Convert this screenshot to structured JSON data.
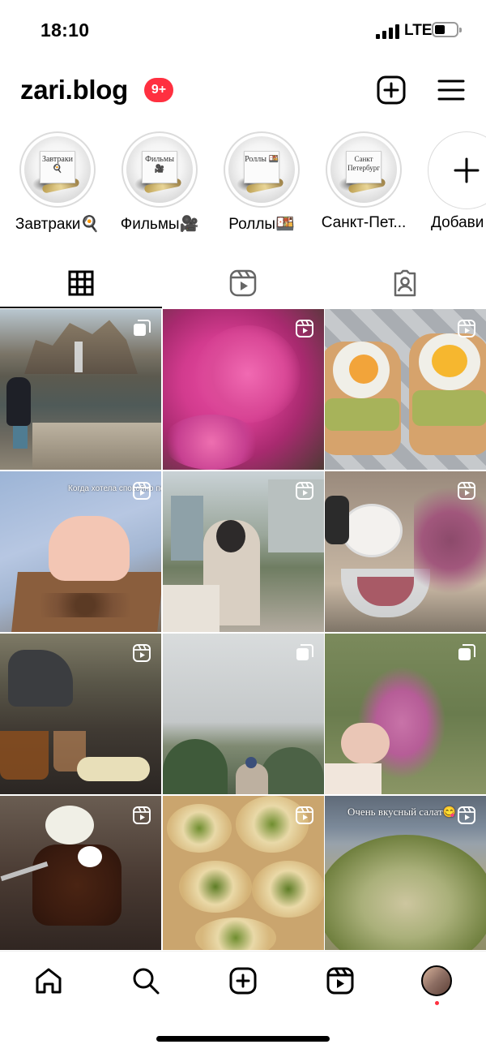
{
  "status_bar": {
    "time": "18:10",
    "network": "LTE"
  },
  "header": {
    "username": "zari.blog",
    "notification_badge": "9+"
  },
  "highlights": [
    {
      "label": "Завтраки🍳",
      "cover_text": "Завтраки 🍳"
    },
    {
      "label": "Фильмы🎥",
      "cover_text": "Фильмы 🎥"
    },
    {
      "label": "Роллы🍱",
      "cover_text": "Роллы 🍱"
    },
    {
      "label": "Санкт-Пет...",
      "cover_text": "Санкт Петербург"
    },
    {
      "label": "Добави"
    }
  ],
  "tabs": [
    {
      "name": "grid",
      "icon": "grid-icon",
      "active": true
    },
    {
      "name": "reels",
      "icon": "reels-icon",
      "active": false
    },
    {
      "name": "tagged",
      "icon": "tagged-icon",
      "active": false
    }
  ],
  "posts": [
    {
      "type": "carousel",
      "subject": "child by pond and rocky waterfall"
    },
    {
      "type": "reel",
      "subject": "pink peonies"
    },
    {
      "type": "reel",
      "subject": "avocado toast with fried eggs"
    },
    {
      "type": "reel",
      "subject": "child hand with chocolate tray",
      "caption": "Когда хотела спокойно попить чай с трайфл..."
    },
    {
      "type": "reel",
      "subject": "mirror selfie on street"
    },
    {
      "type": "reel",
      "subject": "bowl of minced meat in kitchen"
    },
    {
      "type": "reel",
      "subject": "tea pouring by the river"
    },
    {
      "type": "carousel",
      "subject": "person under cloudy sky"
    },
    {
      "type": "carousel",
      "subject": "hand holding heather flowers"
    },
    {
      "type": "reel",
      "subject": "chocolate fondant with ice cream"
    },
    {
      "type": "reel",
      "subject": "pita rolls with greens"
    },
    {
      "type": "reel",
      "subject": "mushroom salad",
      "caption": "Очень вкусный салат😋"
    }
  ],
  "colors": {
    "badge": "#ff3040",
    "active_tab": "#000000",
    "divider": "#dbdbdb"
  }
}
